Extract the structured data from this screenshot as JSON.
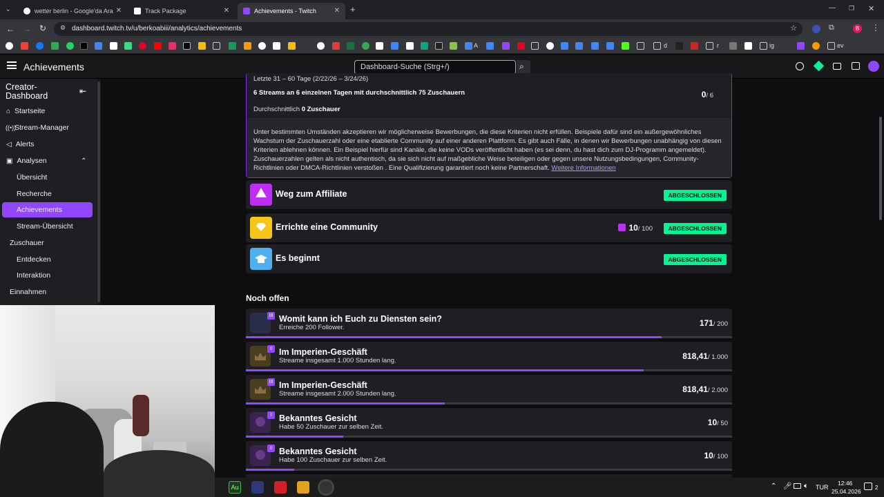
{
  "browser": {
    "tabs": [
      {
        "title": "wetter berlin - Google'da Ara",
        "favicon_color": "#ffffff"
      },
      {
        "title": "Track Package",
        "favicon_color": "#ffffff"
      },
      {
        "title": "Achievements - Twitch",
        "favicon_color": "#9147ff"
      }
    ],
    "url": "dashboard.twitch.tv/u/berkoabiii/analytics/achievements",
    "bookmark_labels": {
      "a": "A",
      "d": "d",
      "r": "r",
      "ev": "ev",
      "ig": "ig"
    }
  },
  "header": {
    "title": "Achievements",
    "search_placeholder": "Dashboard-Suche (Strg+/)"
  },
  "sidebar": {
    "heading": "Creator-Dashboard",
    "items": [
      {
        "label": "Startseite",
        "icon": "home-icon"
      },
      {
        "label": "Stream-Manager",
        "icon": "broadcast-icon"
      },
      {
        "label": "Alerts",
        "icon": "megaphone-icon"
      },
      {
        "label": "Analysen",
        "icon": "analytics-icon"
      },
      {
        "label": "Übersicht"
      },
      {
        "label": "Recherche"
      },
      {
        "label": "Achievements"
      },
      {
        "label": "Stream-Übersicht"
      },
      {
        "label": "Zuschauer"
      },
      {
        "label": "Entdecken"
      },
      {
        "label": "Interaktion"
      },
      {
        "label": "Einnahmen"
      }
    ]
  },
  "criteria": {
    "period": "Letzte 31 – 60 Tage (2/22/26 – 3/24/26)",
    "streams_line": "6 Streams an 6 einzelnen Tagen mit durchschnittlich 75 Zuschauern",
    "streams_value": "0",
    "streams_total": "/ 6",
    "avg_prefix": "Durchschnittlich",
    "avg_value": "0 Zuschauer",
    "note": "Unter bestimmten Umständen akzeptieren wir möglicherweise Bewerbungen, die diese Kriterien nicht erfüllen. Beispiele dafür sind ein außergewöhnliches Wachstum der Zuschauerzahl oder eine etablierte Community auf einer anderen Plattform. Es gibt auch Fälle, in denen wir Bewerbungen unabhängig von diesen Kriterien ablehnen können. Ein Beispiel hierfür sind Kanäle, die keine VODs veröffentlicht haben (es sei denn, du hast dich zum DJ-Programm angemeldet). Zuschauerzahlen gelten als nicht authentisch, da sie sich nicht auf maßgebliche Weise beteiligen oder gegen unsere Nutzungsbedingungen, Community-Richtlinien oder DMCA-Richtlinien verstoßen . Eine Qualifizierung garantiert noch keine Partnerschaft.",
    "more_link": "Weitere Informationen"
  },
  "completed": [
    {
      "title": "Weg zum Affiliate",
      "badge": "ABGESCHLOSSEN",
      "icon_color": "#bf2ef5"
    },
    {
      "title": "Errichte eine Community",
      "badge": "ABGESCHLOSSEN",
      "value": "10",
      "total": "/ 100",
      "icon_color": "#f5c518"
    },
    {
      "title": "Es beginnt",
      "badge": "ABGESCHLOSSEN",
      "icon_color": "#4fb0f0"
    }
  ],
  "open_heading": "Noch offen",
  "open": [
    {
      "tier": "III",
      "title": "Womit kann ich Euch zu Diensten sein?",
      "subtitle": "Erreiche 200 Follower.",
      "value": "171",
      "total": "/ 200",
      "progress": 0.855
    },
    {
      "tier": "II",
      "title": "Im Imperien-Geschäft",
      "subtitle": "Streame insgesamt 1.000 Stunden lang.",
      "value": "818,41",
      "total": "/ 1.000",
      "progress": 0.818
    },
    {
      "tier": "III",
      "title": "Im Imperien-Geschäft",
      "subtitle": "Streame insgesamt 2.000 Stunden lang.",
      "value": "818,41",
      "total": "/ 2.000",
      "progress": 0.409
    },
    {
      "tier": "I",
      "title": "Bekanntes Gesicht",
      "subtitle": "Habe 50 Zuschauer zur selben Zeit.",
      "value": "10",
      "total": "/ 50",
      "progress": 0.2
    },
    {
      "tier": "II",
      "title": "Bekanntes Gesicht",
      "subtitle": "Habe 100 Zuschauer zur selben Zeit.",
      "value": "10",
      "total": "/ 100",
      "progress": 0.1
    }
  ],
  "taskbar": {
    "lang": "TUR",
    "time": "12:46",
    "date": "25.04.2026",
    "notif_count": "2",
    "app_au": "Au"
  },
  "colors": {
    "accent": "#9147ff",
    "badge_green": "#00f593"
  }
}
